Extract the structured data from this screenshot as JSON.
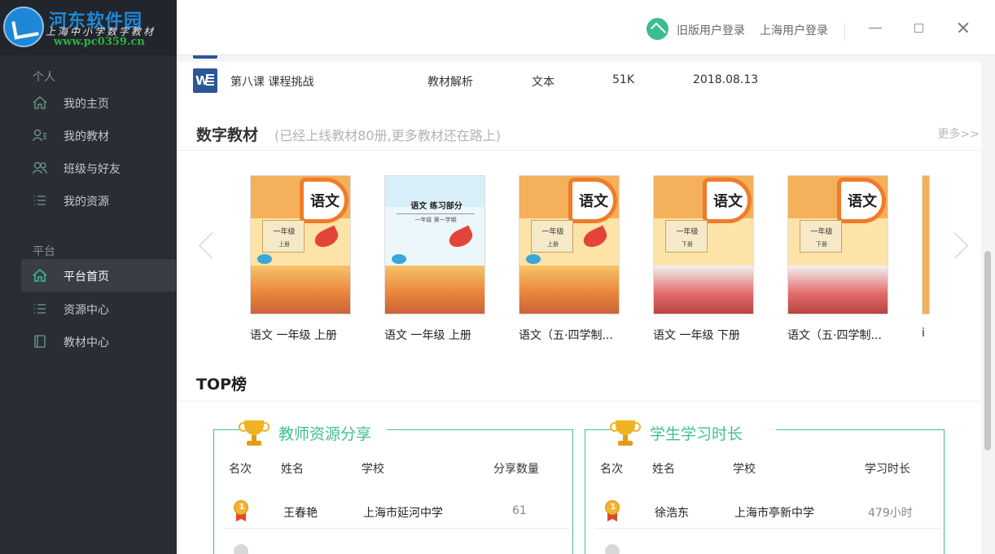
{
  "app": {
    "watermark": "河东软件园",
    "title": "上海中小学数字教材",
    "url": "www.pc0359.cn"
  },
  "sidebar": {
    "personal_label": "个人",
    "personal_items": [
      {
        "label": "我的主页",
        "icon": "home-icon"
      },
      {
        "label": "我的教材",
        "icon": "user-book-icon"
      },
      {
        "label": "班级与好友",
        "icon": "users-icon"
      },
      {
        "label": "我的资源",
        "icon": "list-icon"
      }
    ],
    "platform_label": "平台",
    "platform_items": [
      {
        "label": "平台首页",
        "icon": "home-icon",
        "active": true
      },
      {
        "label": "资源中心",
        "icon": "list-icon"
      },
      {
        "label": "教材中心",
        "icon": "book-icon"
      }
    ]
  },
  "topbar": {
    "login_old": "旧版用户登录",
    "login_sh": "上海用户登录"
  },
  "file_row": {
    "name": "第八课 课程挑战",
    "category": "教材解析",
    "type": "文本",
    "size": "51K",
    "date": "2018.08.13"
  },
  "digital_textbooks": {
    "title": "数字教材",
    "subtitle": "(已经上线教材80册,更多教材还在路上)",
    "more": "更多>>",
    "books": [
      {
        "label": "语文 一年级 上册",
        "badge": "语文",
        "grade": "一年级",
        "term": "上册",
        "style": "autumn"
      },
      {
        "label": "语文 一年级 上册",
        "badge": "语文",
        "grade": "练习部分",
        "term": "一年级 第一学期",
        "style": "exercise"
      },
      {
        "label": "语文（五·四学制...",
        "badge": "语文",
        "grade": "一年级",
        "term": "上册",
        "style": "autumn"
      },
      {
        "label": "语文 一年级 下册",
        "badge": "语文",
        "grade": "一年级",
        "term": "下册",
        "style": "winter"
      },
      {
        "label": "语文（五·四学制...",
        "badge": "语文",
        "grade": "一年级",
        "term": "下册",
        "style": "winter"
      }
    ],
    "partial_label": "i"
  },
  "top_list": {
    "title": "TOP榜",
    "teacher": {
      "title": "教师资源分享",
      "headers": [
        "名次",
        "姓名",
        "学校",
        "分享数量"
      ],
      "rows": [
        {
          "rank": "1",
          "name": "王春艳",
          "school": "上海市延河中学",
          "value": "61"
        }
      ]
    },
    "student": {
      "title": "学生学习时长",
      "headers": [
        "名次",
        "姓名",
        "学校",
        "学习时长"
      ],
      "rows": [
        {
          "rank": "1",
          "name": "徐浩东",
          "school": "上海市亭新中学",
          "value": "479小时"
        }
      ]
    }
  },
  "colors": {
    "sidebar_bg": "#2b2d35",
    "accent": "#3ebf97",
    "gold": "#f0b323"
  }
}
